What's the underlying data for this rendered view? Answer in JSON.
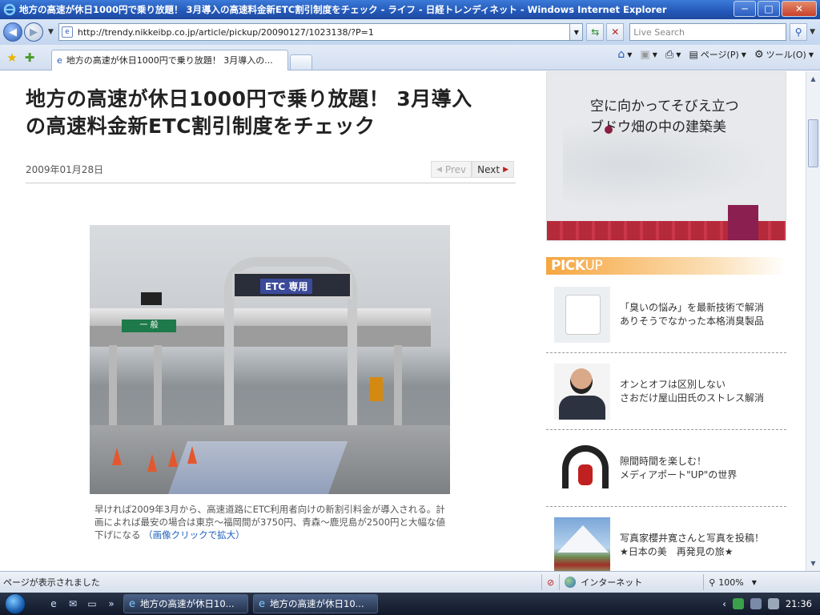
{
  "window": {
    "title": "地方の高速が休日1000円で乗り放題！ 3月導入の高速料金新ETC割引制度をチェック - ライフ - 日経トレンディネット - Windows Internet Explorer",
    "minimize": "─",
    "maximize": "□",
    "close": "✕"
  },
  "address": {
    "url": "http://trendy.nikkeibp.co.jp/article/pickup/20090127/1023138/?P=1",
    "search_placeholder": "Live Search"
  },
  "tabs": {
    "active_tab": "地方の高速が休日1000円で乗り放題！ 3月導入の...",
    "page_label": "ページ(P)",
    "tools_label": "ツール(O)"
  },
  "article": {
    "headline_line1": "地方の高速が休日1000円で乗り放題！ 3月導入",
    "headline_line2": "の高速料金新ETC割引制度をチェック",
    "date": "2009年01月28日",
    "prev": "Prev",
    "next": "Next",
    "photo_sign": "ETC 専用",
    "photo_sign2": "一 般",
    "caption": "早ければ2009年3月から、高速道路にETC利用者向けの新割引料金が導入される。計画によれば最安の場合は東京～福岡間が3750円、青森～鹿児島が2500円と大幅な値下げになる",
    "caption_link": "（画像クリックで拡大）"
  },
  "sidebar": {
    "banner_line1": "空に向かってそびえ立つ",
    "banner_line2": "ブドウ畑の中の建築美",
    "pickup_pick": "PICK",
    "pickup_up": "UP",
    "items": [
      {
        "line1": "「臭いの悩み」を最新技術で解消",
        "line2": "ありそうでなかった本格消臭製品"
      },
      {
        "line1": "オンとオフは区別しない",
        "line2": "さおだけ屋山田氏のストレス解消"
      },
      {
        "line1": "隙間時間を楽しむ！",
        "line2": "メディアポート\"UP\"の世界"
      },
      {
        "line1": "写真家櫻井寛さんと写真を投稿！",
        "line2": "★日本の美　再発見の旅★"
      }
    ]
  },
  "status": {
    "text": "ページが表示されました",
    "zone": "インターネット",
    "zoom": "100%"
  },
  "taskbar": {
    "task1": "地方の高速が休日10...",
    "task2": "地方の高速が休日10...",
    "clock": "21:36"
  }
}
